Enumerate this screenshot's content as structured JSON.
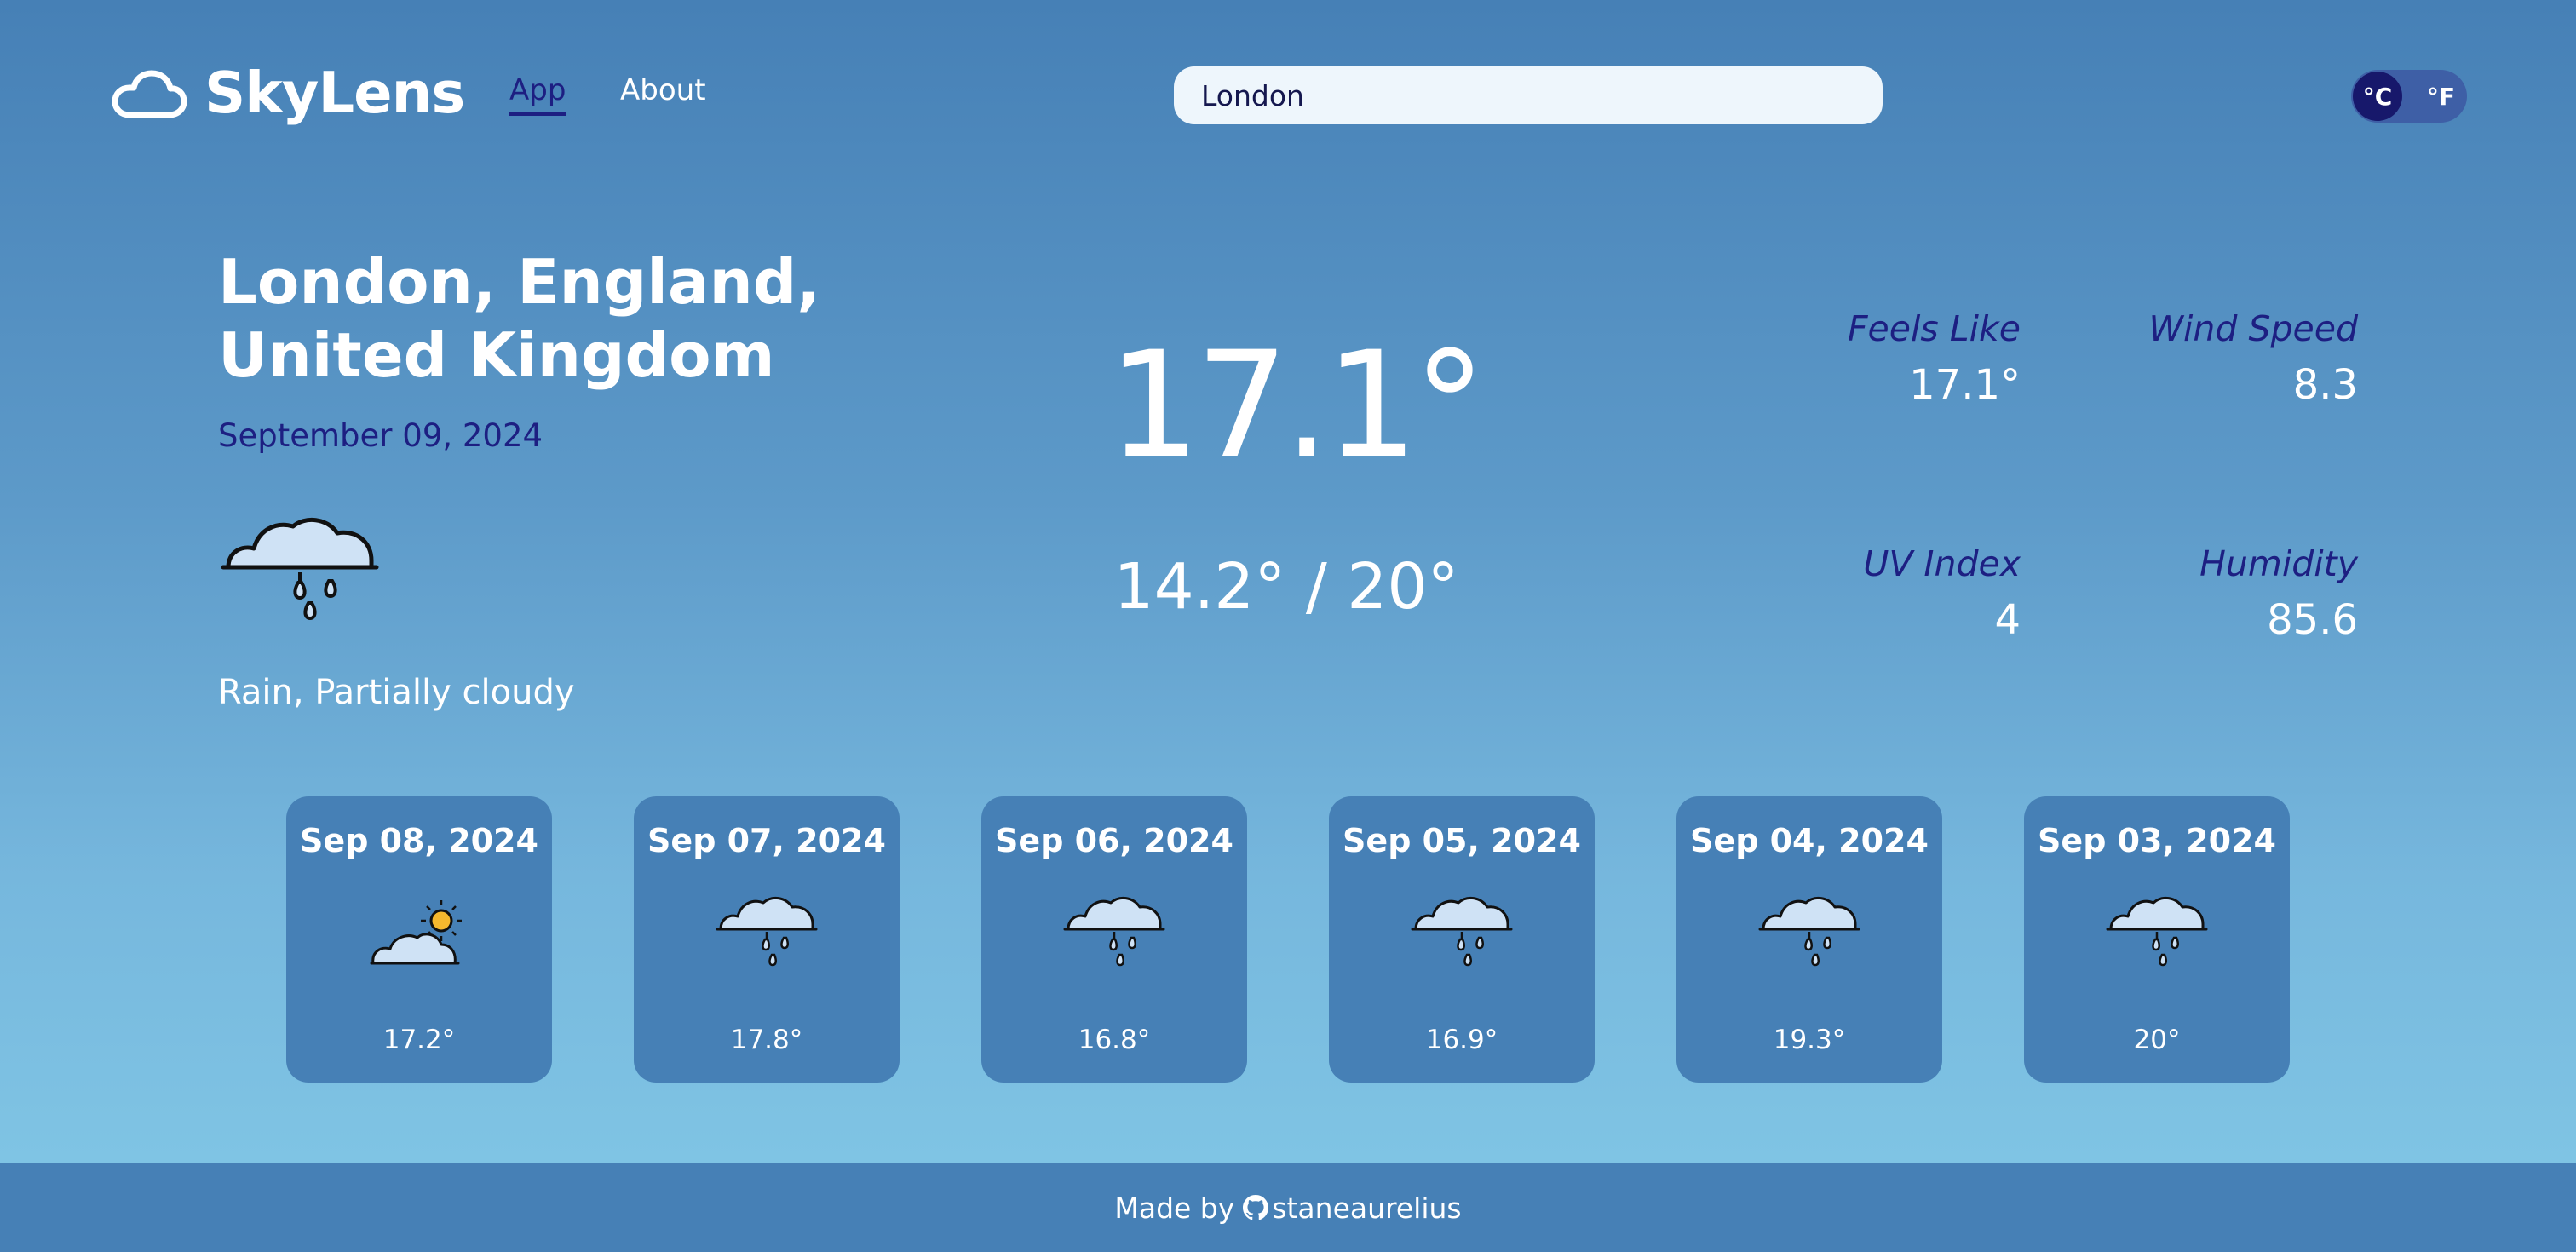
{
  "app": {
    "name": "SkyLens"
  },
  "nav": {
    "items": [
      {
        "label": "App",
        "active": true
      },
      {
        "label": "About",
        "active": false
      }
    ]
  },
  "search": {
    "value": "London"
  },
  "units": {
    "celsius": "°C",
    "fahrenheit": "°F",
    "selected": "°C"
  },
  "current": {
    "location": "London, England, United Kingdom",
    "date": "September 09, 2024",
    "icon": "rain-cloud-icon",
    "condition": "Rain, Partially cloudy",
    "temp": "17.1°",
    "range": "14.2° / 20°",
    "stats": {
      "feels_like": {
        "label": "Feels Like",
        "value": "17.1°"
      },
      "wind_speed": {
        "label": "Wind Speed",
        "value": "8.3"
      },
      "uv_index": {
        "label": "UV Index",
        "value": "4"
      },
      "humidity": {
        "label": "Humidity",
        "value": "85.6"
      }
    }
  },
  "forecast": [
    {
      "date": "Sep 08, 2024",
      "icon": "partly-cloudy-icon",
      "temp": "17.2°"
    },
    {
      "date": "Sep 07, 2024",
      "icon": "rain-cloud-icon",
      "temp": "17.8°"
    },
    {
      "date": "Sep 06, 2024",
      "icon": "rain-cloud-icon",
      "temp": "16.8°"
    },
    {
      "date": "Sep 05, 2024",
      "icon": "rain-cloud-icon",
      "temp": "16.9°"
    },
    {
      "date": "Sep 04, 2024",
      "icon": "rain-cloud-icon",
      "temp": "19.3°"
    },
    {
      "date": "Sep 03, 2024",
      "icon": "rain-cloud-icon",
      "temp": "20°"
    }
  ],
  "footer": {
    "prefix": "Made by",
    "author": "staneaurelius"
  },
  "colors": {
    "accent": "#1d1f82",
    "card": "#4680b6",
    "search_bg": "#eef6fc"
  }
}
